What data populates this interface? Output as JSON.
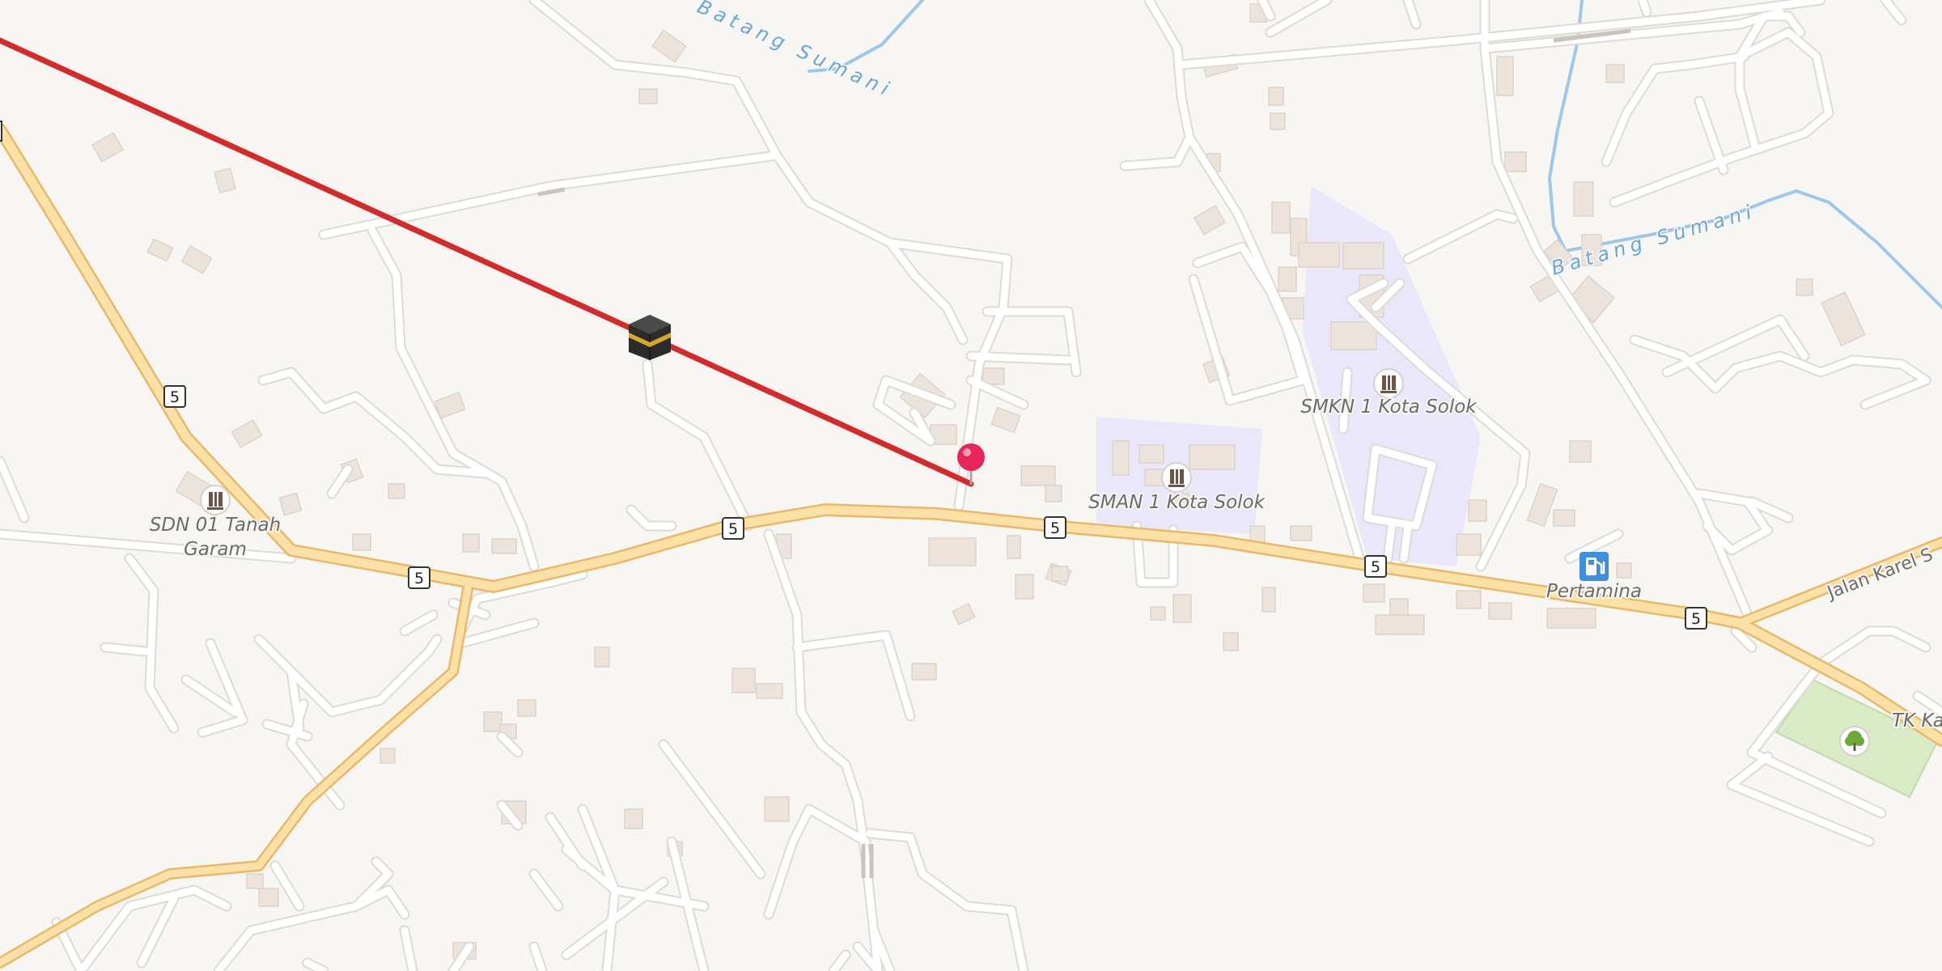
{
  "map": {
    "colors": {
      "background": "#f8f6f3",
      "minor_road": "#ffffff",
      "minor_road_casing": "#dedad4",
      "major_road": "#fbe1a6",
      "major_road_casing": "#e8b96a",
      "water": "#9ec7ea",
      "school_area": "#ebe7fb",
      "park_area": "#d8ebc6",
      "building": "#ece4dc",
      "route_line": "#d62a2a",
      "pin": "#e8245a"
    },
    "route_shields": [
      "5",
      "5",
      "5",
      "5",
      "5",
      "5"
    ],
    "places": {
      "sdn": {
        "line1": "SDN 01 Tanah",
        "line2": "Garam",
        "icon": "school-icon"
      },
      "sman": {
        "label": "SMAN 1 Kota Solok",
        "icon": "school-icon"
      },
      "smkn": {
        "label": "SMKN 1 Kota Solok",
        "icon": "school-icon"
      },
      "fuel": {
        "label": "Pertamina",
        "icon": "fuel-pump-icon"
      },
      "tk": {
        "label": "TK Ka",
        "icon": "park-tree-icon"
      }
    },
    "waterways": {
      "upper": "Batang Sumani",
      "right": "Batang Sumani"
    },
    "streets": {
      "karel": "Jalan Karel S"
    },
    "markers": {
      "kaaba": "kaaba-icon",
      "pin": "map-pin-icon"
    }
  }
}
